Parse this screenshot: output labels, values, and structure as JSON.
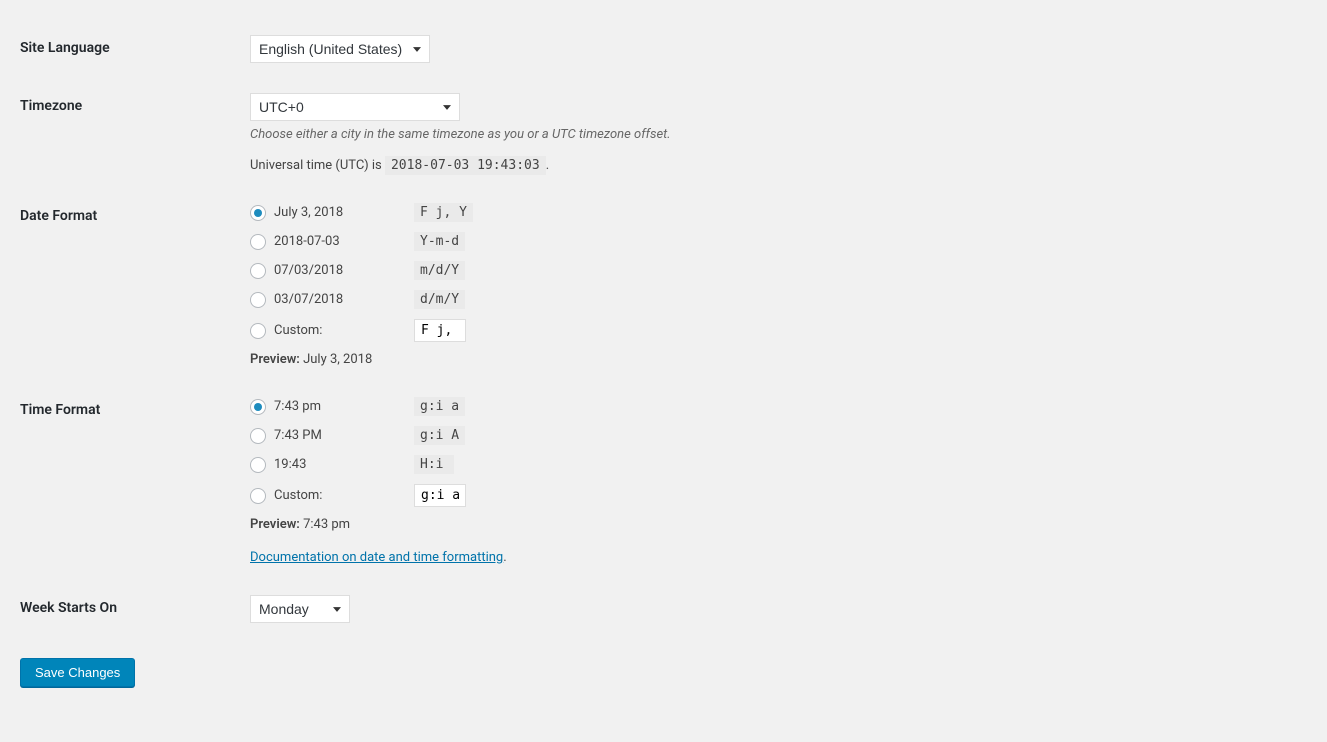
{
  "site_language": {
    "label": "Site Language",
    "value": "English (United States)"
  },
  "timezone": {
    "label": "Timezone",
    "value": "UTC+0",
    "description": "Choose either a city in the same timezone as you or a UTC timezone offset.",
    "utc_prefix": "Universal time (UTC) is ",
    "utc_time": "2018-07-03 19:43:03",
    "utc_suffix": "."
  },
  "date_format": {
    "label": "Date Format",
    "options": [
      {
        "example": "July 3, 2018",
        "code": "F j, Y",
        "checked": true
      },
      {
        "example": "2018-07-03",
        "code": "Y-m-d",
        "checked": false
      },
      {
        "example": "07/03/2018",
        "code": "m/d/Y",
        "checked": false
      },
      {
        "example": "03/07/2018",
        "code": "d/m/Y",
        "checked": false
      }
    ],
    "custom_label": "Custom:",
    "custom_value": "F j, Y",
    "preview_label": "Preview:",
    "preview_value": "July 3, 2018"
  },
  "time_format": {
    "label": "Time Format",
    "options": [
      {
        "example": "7:43 pm",
        "code": "g:i a",
        "checked": true
      },
      {
        "example": "7:43 PM",
        "code": "g:i A",
        "checked": false
      },
      {
        "example": "19:43",
        "code": "H:i",
        "checked": false
      }
    ],
    "custom_label": "Custom:",
    "custom_value": "g:i a",
    "preview_label": "Preview:",
    "preview_value": "7:43 pm",
    "doc_link_text": "Documentation on date and time formatting"
  },
  "week_starts": {
    "label": "Week Starts On",
    "value": "Monday"
  },
  "submit": {
    "label": "Save Changes"
  }
}
